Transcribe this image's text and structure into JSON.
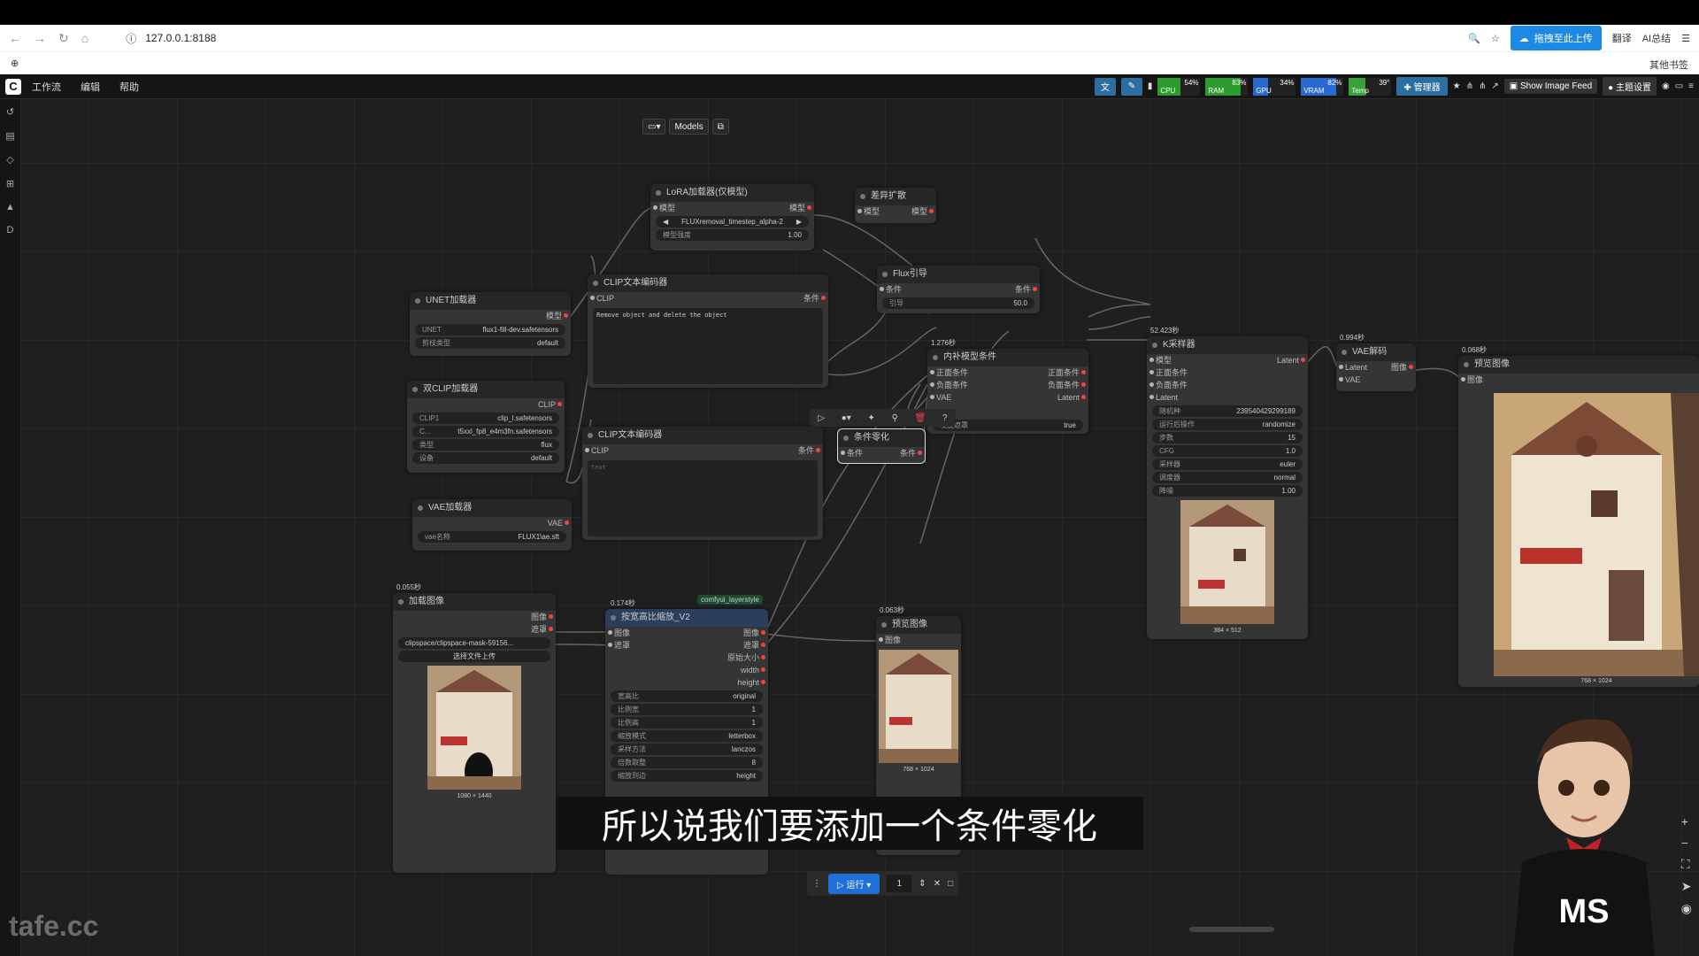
{
  "browser": {
    "url": "127.0.0.1:8188",
    "upload_label": "拖拽至此上传",
    "translate_label": "翻译",
    "ai_label": "AI总结",
    "other_bookmarks": "其他书签"
  },
  "menubar": {
    "logo": "C",
    "menu_items": [
      "工作流",
      "编辑",
      "帮助"
    ],
    "meters": [
      {
        "label": "CPU",
        "value": "54%",
        "color": "#2e9b2e"
      },
      {
        "label": "RAM",
        "value": "83%",
        "color": "#2e9b2e"
      },
      {
        "label": "GPU",
        "value": "34%",
        "color": "#2a6ad0"
      },
      {
        "label": "VRAM",
        "value": "82%",
        "color": "#2a6ad0"
      },
      {
        "label": "Temp",
        "value": "39°",
        "color": "#3aa03a"
      }
    ],
    "manager_label": "管理器",
    "feed_label": "Show Image Feed",
    "theme_label": "主题设置"
  },
  "canvas_toolbar": {
    "models_label": "Models"
  },
  "nodes": {
    "lora": {
      "title": "LoRA加载器(仅模型)",
      "in_model": "模型",
      "out_model": "模型",
      "lora_name": "FLUXremoval_timestep_alpha-2",
      "strength_label": "模型强度",
      "strength": "1.00"
    },
    "diff": {
      "title": "差异扩散",
      "in_model": "模型",
      "out_model": "模型"
    },
    "unet": {
      "title": "UNET加载器",
      "out": "模型",
      "unet_label": "UNET",
      "unet_name": "flux1-fill-dev.safetensors",
      "dtype_label": "剪枝类型",
      "dtype": "default"
    },
    "clip_text1": {
      "title": "CLIP文本编码器",
      "in": "CLIP",
      "out": "条件",
      "text": "Remove object and delete the object"
    },
    "clip_text2": {
      "title": "CLIP文本编码器",
      "in": "CLIP",
      "out": "条件",
      "text": "text"
    },
    "flux_guidance": {
      "title": "Flux引导",
      "in": "条件",
      "out": "条件",
      "guidance_label": "引导",
      "guidance": "50.0"
    },
    "dual_clip": {
      "title": "双CLIP加载器",
      "out": "CLIP",
      "clip1_label": "CLIP1",
      "clip1": "clip_l.safetensors",
      "clip2_label": "C...",
      "clip2": "t5xxl_fp8_e4m3fn.safetensors",
      "type_label": "类型",
      "type": "flux",
      "device_label": "设备",
      "device": "default"
    },
    "inpaint": {
      "time": "1.276秒",
      "title": "内补模型条件",
      "in_pos": "正面条件",
      "in_neg": "负面条件",
      "in_vae": "VAE",
      "out_pos": "正面条件",
      "out_neg": "负面条件",
      "out_latent": "Latent",
      "noise_mask_label": "噪波遮罩",
      "noise_mask": "true"
    },
    "zero": {
      "title": "条件零化",
      "in": "条件",
      "out": "条件"
    },
    "vae_loader": {
      "title": "VAE加载器",
      "out": "VAE",
      "vae_label": "vae名称",
      "vae": "FLUX1\\ae.sft"
    },
    "ksampler": {
      "time": "52.423秒",
      "title": "K采样器",
      "in_model": "模型",
      "in_pos": "正面条件",
      "in_neg": "负面条件",
      "in_latent": "Latent",
      "out": "Latent",
      "seed_label": "随机种",
      "seed": "239540429299189",
      "control_label": "运行后操作",
      "control": "randomize",
      "steps_label": "步数",
      "steps": "15",
      "cfg_label": "CFG",
      "cfg": "1.0",
      "sampler_label": "采样器",
      "sampler": "euler",
      "scheduler_label": "调度器",
      "scheduler": "normal",
      "denoise_label": "降噪",
      "denoise": "1.00",
      "size": "384 × 512"
    },
    "vae_decode": {
      "time": "0.994秒",
      "title": "VAE解码",
      "in_latent": "Latent",
      "in_vae": "VAE",
      "out": "图像"
    },
    "preview_big": {
      "time": "0.068秒",
      "title": "预览图像",
      "in": "图像",
      "size": "768 × 1024"
    },
    "load_image": {
      "time": "0.055秒",
      "title": "加载图像",
      "out_image": "图像",
      "out_mask": "遮罩",
      "file": "clipspace/clipspace-mask-59156...",
      "upload_label": "选择文件上传",
      "size": "1080 × 1440"
    },
    "resize": {
      "time": "0.174秒",
      "badge": "comfyui_layerstyle",
      "title": "按宽高比缩放_V2",
      "in_image": "图像",
      "in_mask": "遮罩",
      "out_image": "图像",
      "out_mask": "遮罩",
      "out_orig": "原始大小",
      "out_w": "width",
      "out_h": "height",
      "aspect_label": "宽高比",
      "aspect": "original",
      "pw_label": "比例宽",
      "pw": "1",
      "ph_label": "比例高",
      "ph": "1",
      "fit_label": "缩放模式",
      "fit": "letterbox",
      "method_label": "采样方法",
      "method": "lanczos",
      "round_label": "倍数取整",
      "round": "8",
      "scale_label": "缩放到边",
      "scale": "height"
    },
    "preview_small": {
      "time": "0.063秒",
      "title": "预览图像",
      "in": "图像",
      "size": "768 × 1024"
    }
  },
  "subtitle": "所以说我们要添加一个条件零化",
  "run_bar": {
    "run_label": "运行",
    "count": "1"
  },
  "watermark": "tafe.cc",
  "avatar_text": "MS"
}
